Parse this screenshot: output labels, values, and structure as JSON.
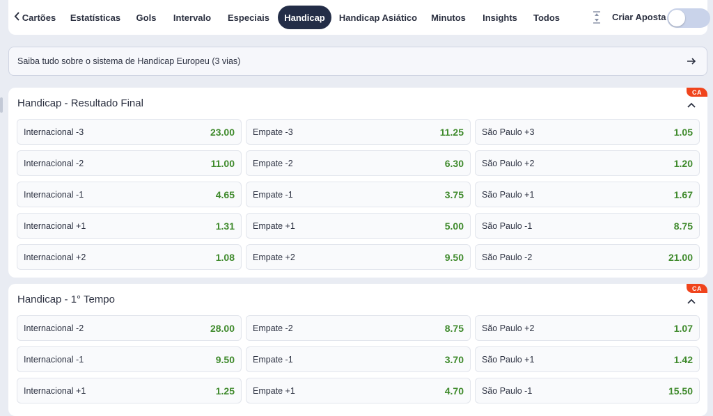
{
  "tabs": [
    {
      "label": "Cartões",
      "back": true
    },
    {
      "label": "Estatísticas"
    },
    {
      "label": "Gols"
    },
    {
      "label": "Intervalo"
    },
    {
      "label": "Especiais"
    },
    {
      "label": "Handicap",
      "active": true
    },
    {
      "label": "Handicap Asiático"
    },
    {
      "label": "Minutos"
    },
    {
      "label": "Insights"
    },
    {
      "label": "Todos"
    }
  ],
  "criar_aposta": {
    "label": "Criar Aposta",
    "icon": "bet-builder-icon",
    "enabled": false
  },
  "info_banner": {
    "text": "Saiba tudo sobre o sistema de Handicap Europeu (3 vias)",
    "icon": "arrow-right-icon"
  },
  "colors": {
    "accent": "#232d47",
    "odds": "#3f8a2c",
    "badge": "#f0441c",
    "toggle": "#c9d3ea"
  },
  "markets": [
    {
      "title": "Handicap - Resultado Final",
      "badge": "CA",
      "rows": [
        [
          {
            "label": "Internacional -3",
            "odd": "23.00"
          },
          {
            "label": "Empate -3",
            "odd": "11.25"
          },
          {
            "label": "São Paulo +3",
            "odd": "1.05"
          }
        ],
        [
          {
            "label": "Internacional -2",
            "odd": "11.00"
          },
          {
            "label": "Empate -2",
            "odd": "6.30"
          },
          {
            "label": "São Paulo +2",
            "odd": "1.20"
          }
        ],
        [
          {
            "label": "Internacional -1",
            "odd": "4.65"
          },
          {
            "label": "Empate -1",
            "odd": "3.75"
          },
          {
            "label": "São Paulo +1",
            "odd": "1.67"
          }
        ],
        [
          {
            "label": "Internacional +1",
            "odd": "1.31"
          },
          {
            "label": "Empate +1",
            "odd": "5.00"
          },
          {
            "label": "São Paulo -1",
            "odd": "8.75"
          }
        ],
        [
          {
            "label": "Internacional +2",
            "odd": "1.08"
          },
          {
            "label": "Empate +2",
            "odd": "9.50"
          },
          {
            "label": "São Paulo -2",
            "odd": "21.00"
          }
        ]
      ]
    },
    {
      "title": "Handicap - 1° Tempo",
      "badge": "CA",
      "rows": [
        [
          {
            "label": "Internacional -2",
            "odd": "28.00"
          },
          {
            "label": "Empate -2",
            "odd": "8.75"
          },
          {
            "label": "São Paulo +2",
            "odd": "1.07"
          }
        ],
        [
          {
            "label": "Internacional -1",
            "odd": "9.50"
          },
          {
            "label": "Empate -1",
            "odd": "3.70"
          },
          {
            "label": "São Paulo +1",
            "odd": "1.42"
          }
        ],
        [
          {
            "label": "Internacional +1",
            "odd": "1.25"
          },
          {
            "label": "Empate +1",
            "odd": "4.70"
          },
          {
            "label": "São Paulo -1",
            "odd": "15.50"
          }
        ]
      ]
    }
  ]
}
